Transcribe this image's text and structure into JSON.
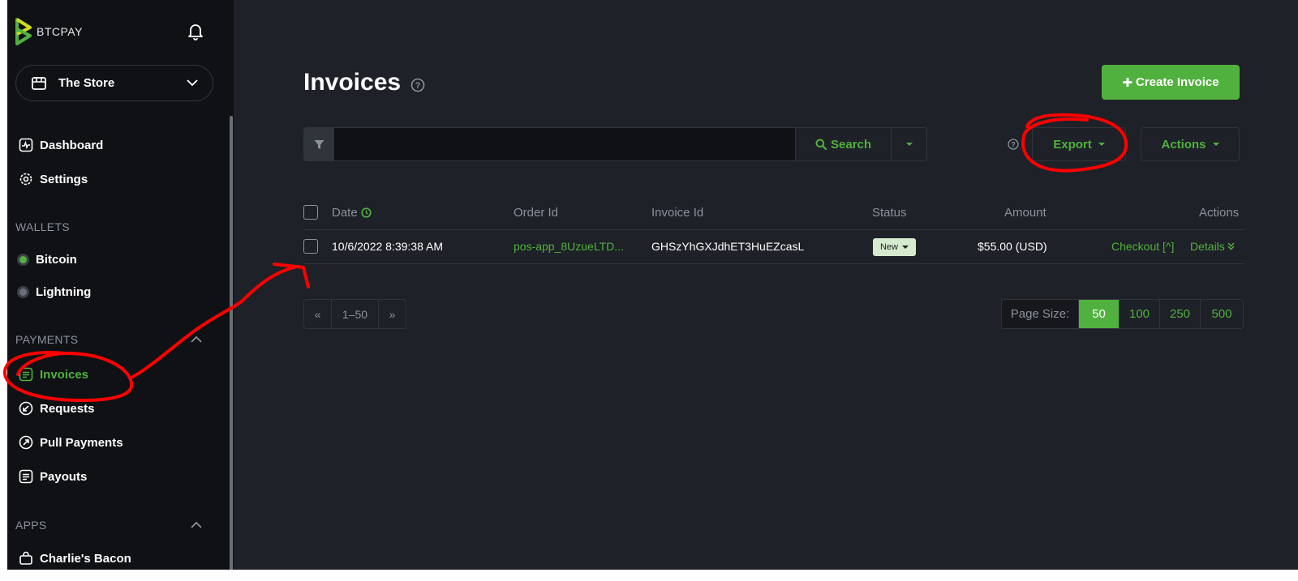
{
  "brand": {
    "name": "BTCPAY",
    "color": "#51b13e"
  },
  "store": {
    "name": "The Store"
  },
  "nav": {
    "dashboard": "Dashboard",
    "settings": "Settings",
    "wallets_header": "WALLETS",
    "bitcoin": "Bitcoin",
    "lightning": "Lightning",
    "payments_header": "PAYMENTS",
    "invoices": "Invoices",
    "requests": "Requests",
    "pull_payments": "Pull Payments",
    "payouts": "Payouts",
    "apps_header": "APPS",
    "app1": "Charlie's Bacon"
  },
  "page": {
    "title": "Invoices",
    "create_label": "Create Invoice"
  },
  "toolbar": {
    "search_label": "Search",
    "search_value": "",
    "export_label": "Export",
    "actions_label": "Actions"
  },
  "table": {
    "headers": {
      "date": "Date",
      "order_id": "Order Id",
      "invoice_id": "Invoice Id",
      "status": "Status",
      "amount": "Amount",
      "actions": "Actions"
    },
    "rows": [
      {
        "date": "10/6/2022 8:39:38 AM",
        "order_id": "pos-app_8UzueLTD...",
        "invoice_id": "GHSzYhGXJdhET3HuEZcasL",
        "status": "New",
        "amount": "$55.00 (USD)",
        "checkout": "Checkout [^]",
        "details": "Details"
      }
    ]
  },
  "pagination": {
    "prev": "«",
    "range": "1–50",
    "next": "»"
  },
  "page_size": {
    "label": "Page Size:",
    "options": [
      "50",
      "100",
      "250",
      "500"
    ],
    "selected": "50"
  },
  "colors": {
    "accent": "#51b13e",
    "bg": "#1e2127",
    "sidebar": "#0f1115",
    "annotation": "#ff0000"
  }
}
